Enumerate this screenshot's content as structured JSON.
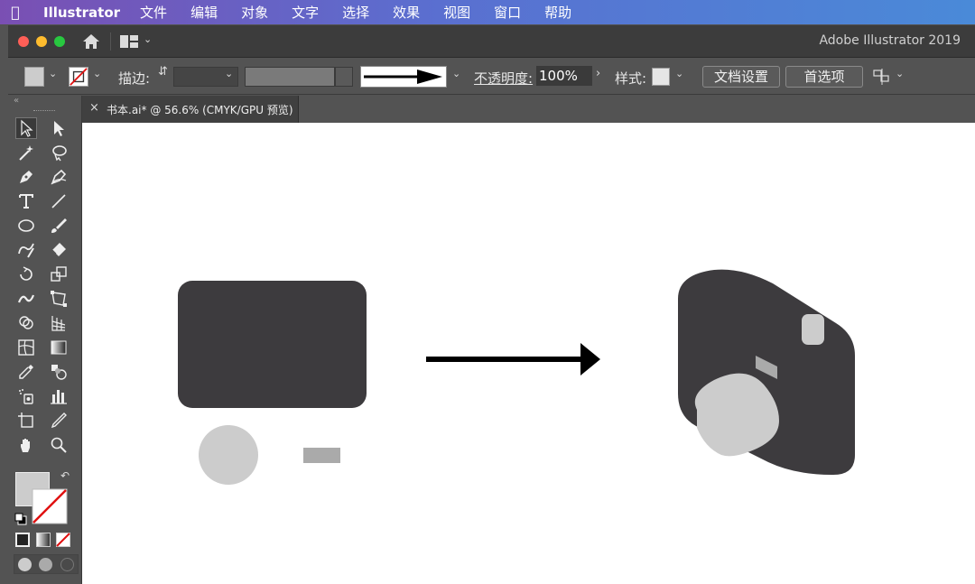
{
  "menubar": {
    "app_name": "Illustrator",
    "items": [
      "文件",
      "编辑",
      "对象",
      "文字",
      "选择",
      "效果",
      "视图",
      "窗口",
      "帮助"
    ]
  },
  "window": {
    "title": "Adobe Illustrator 2019"
  },
  "controlbar": {
    "stroke_label": "描边:",
    "opacity_label": "不透明度:",
    "opacity_value": "100%",
    "style_label": "样式:",
    "doc_setup_button": "文档设置",
    "preferences_button": "首选项"
  },
  "document_tab": {
    "close": "×",
    "title": "书本.ai* @ 56.6% (CMYK/GPU 预览)"
  },
  "colors": {
    "dark_shape": "#3d3b3e",
    "light_gray": "#cccccc",
    "mid_gray": "#aaaaaa",
    "menubar_gradient": [
      "#7a4fb3",
      "#4a8ad8"
    ]
  },
  "tools": [
    "selection-tool",
    "direct-selection-tool",
    "magic-wand-tool",
    "lasso-tool",
    "pen-tool",
    "curvature-tool",
    "type-tool",
    "line-tool",
    "ellipse-tool",
    "paintbrush-tool",
    "shaper-tool",
    "eraser-tool",
    "rotate-tool",
    "scale-tool",
    "width-tool",
    "free-transform-tool",
    "shape-builder-tool",
    "perspective-grid-tool",
    "mesh-tool",
    "gradient-tool",
    "eyedropper-tool",
    "blend-tool",
    "symbol-sprayer-tool",
    "column-graph-tool",
    "artboard-tool",
    "slice-tool",
    "hand-tool",
    "zoom-tool"
  ]
}
